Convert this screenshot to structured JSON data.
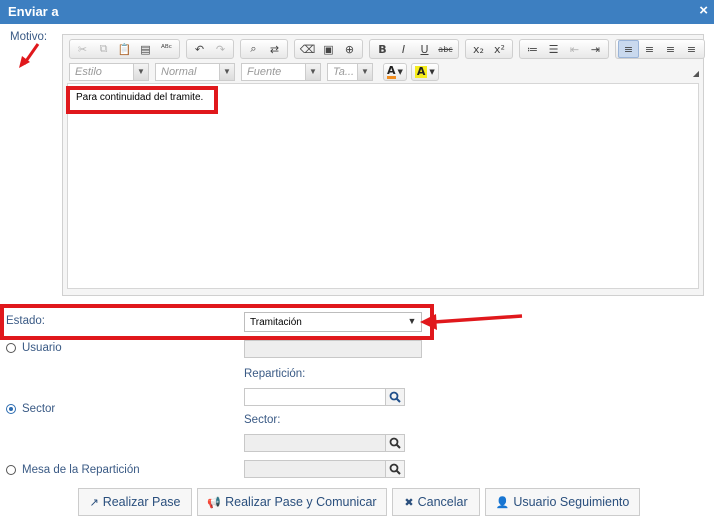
{
  "dialog": {
    "title": "Enviar a",
    "close_icon": "×"
  },
  "form": {
    "motivo_label": "Motivo:",
    "estado_label": "Estado:",
    "estado_value": "Tramitación",
    "editor_text": "Para continuidad del tramite."
  },
  "toolbar": {
    "row1": [
      {
        "name": "cut-icon",
        "glyph": "✂",
        "disabled": true
      },
      {
        "name": "copy-icon",
        "glyph": "⧉",
        "disabled": true
      },
      {
        "name": "paste-icon",
        "glyph": "📋",
        "disabled": false
      },
      {
        "name": "paste-word-icon",
        "glyph": "▤",
        "disabled": false
      },
      {
        "name": "spellcheck-icon",
        "glyph": "ᴬᴮᶜ",
        "disabled": false
      },
      {
        "name": "undo-icon",
        "glyph": "↶",
        "disabled": false
      },
      {
        "name": "redo-icon",
        "glyph": "↷",
        "disabled": true
      },
      {
        "name": "find-icon",
        "glyph": "⌕",
        "disabled": false
      },
      {
        "name": "replace-icon",
        "glyph": "⇄",
        "disabled": false
      },
      {
        "name": "eraser-icon",
        "glyph": "⌫",
        "disabled": false
      },
      {
        "name": "select-all-icon",
        "glyph": "▣",
        "disabled": false
      },
      {
        "name": "spellcheck-scayt-icon",
        "glyph": "⊕",
        "disabled": false
      },
      {
        "name": "bold-icon",
        "glyph": "B",
        "disabled": false
      },
      {
        "name": "italic-icon",
        "glyph": "I",
        "disabled": false
      },
      {
        "name": "underline-icon",
        "glyph": "U",
        "disabled": false
      },
      {
        "name": "strikethrough-icon",
        "glyph": "abc",
        "disabled": false
      },
      {
        "name": "subscript-icon",
        "glyph": "x₂",
        "disabled": false
      },
      {
        "name": "superscript-icon",
        "glyph": "x²",
        "disabled": false
      },
      {
        "name": "numbered-list-icon",
        "glyph": "≔",
        "disabled": false
      },
      {
        "name": "bulleted-list-icon",
        "glyph": "☰",
        "disabled": false
      },
      {
        "name": "outdent-icon",
        "glyph": "⇤",
        "disabled": true
      },
      {
        "name": "indent-icon",
        "glyph": "⇥",
        "disabled": false
      },
      {
        "name": "align-left-icon",
        "glyph": "≡",
        "disabled": false,
        "active": true
      },
      {
        "name": "align-center-icon",
        "glyph": "≡",
        "disabled": false
      },
      {
        "name": "align-right-icon",
        "glyph": "≡",
        "disabled": false
      },
      {
        "name": "align-justify-icon",
        "glyph": "≡",
        "disabled": false
      }
    ],
    "style_combo": "Estilo",
    "format_combo": "Normal",
    "font_combo": "Fuente",
    "size_combo": "Ta...",
    "text_color_glyph": "A",
    "bg_color_glyph": "A"
  },
  "options": {
    "usuario": "Usuario",
    "sector": "Sector",
    "mesa": "Mesa de la Repartición",
    "reparticion_label": "Repartición:",
    "sector_label": "Sector:",
    "selected": "sector"
  },
  "buttons": {
    "realizar_pase": "Realizar Pase",
    "realizar_comunicar": "Realizar Pase y Comunicar",
    "cancelar": "Cancelar",
    "seguimiento": "Usuario Seguimiento"
  },
  "colors": {
    "titlebar": "#3d7fc1",
    "highlight": "#e0181c",
    "link": "#2a4f7d"
  }
}
